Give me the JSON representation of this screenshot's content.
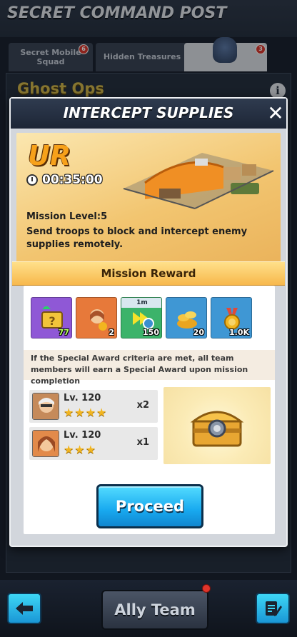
{
  "screen": {
    "title": "SECRET COMMAND POST",
    "tabs": [
      {
        "label": "Secret Mobile Squad",
        "badge": "6"
      },
      {
        "label": "Hidden Treasures"
      },
      {
        "label": "",
        "badge": "3"
      }
    ],
    "section_title": "Ghost Ops",
    "info_icon": "i"
  },
  "modal": {
    "title": "INTERCEPT SUPPLIES",
    "close_label": "✕",
    "rarity": "UR",
    "timer": "00:35:00",
    "mission_level": "Mission Level:5",
    "description": "Send troops to block and intercept enemy supplies remotely.",
    "reward_title": "Mission Reward",
    "rewards": [
      {
        "icon": "mystery-box-icon",
        "qty": "77",
        "bg": "#8f58d6"
      },
      {
        "icon": "hero-shard-icon",
        "qty": "2",
        "bg": "#e7793a"
      },
      {
        "icon": "speedup-icon",
        "qty": "150",
        "tag": "1m",
        "bg": "#3cb36a"
      },
      {
        "icon": "gold-coins-icon",
        "qty": "20",
        "bg": "#3f97d4"
      },
      {
        "icon": "medal-icon",
        "qty": "1.0K",
        "bg": "#3f97d4"
      }
    ],
    "special_note": "If the Special Award criteria are met, all team members will earn a Special Award upon mission completion",
    "requirements": [
      {
        "level": "Lv. 120",
        "stars": "★★★★",
        "multiplier": "x2"
      },
      {
        "level": "Lv. 120",
        "stars": "★★★",
        "multiplier": "x1"
      }
    ],
    "proceed_label": "Proceed"
  },
  "bottom": {
    "ally_label": "Ally Team"
  }
}
